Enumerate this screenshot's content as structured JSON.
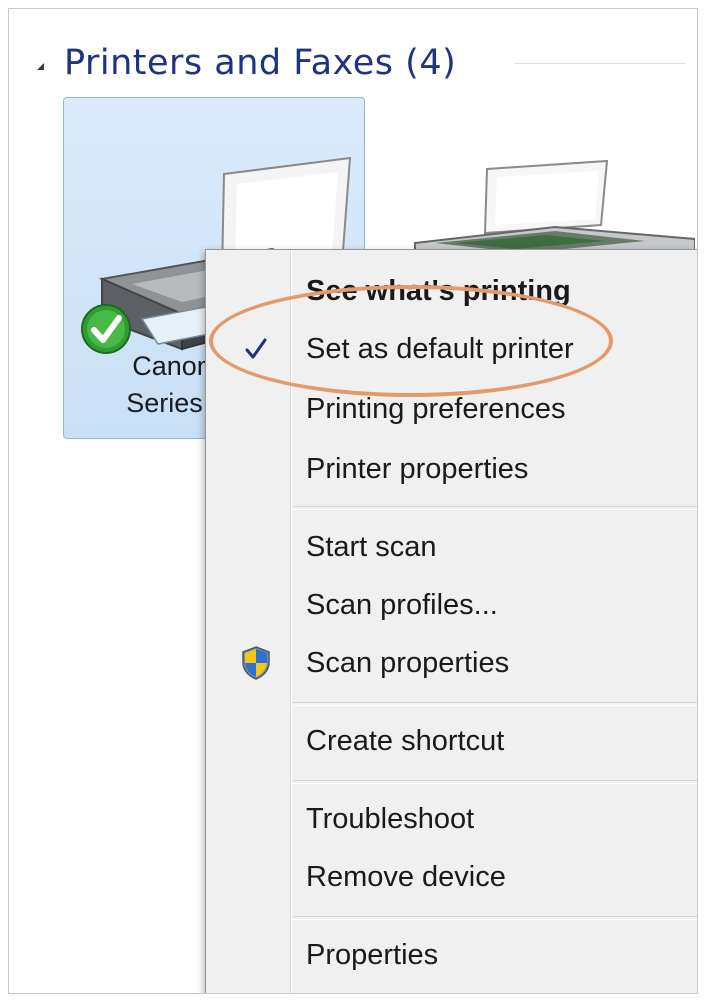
{
  "group": {
    "title": "Printers and Faxes (4)"
  },
  "devices": [
    {
      "name_line1": "Canon",
      "name_line2": "Series I"
    }
  ],
  "context_menu": {
    "items": [
      {
        "label": "See what's printing",
        "bold": true
      },
      {
        "label": "Set as default printer",
        "checked": true
      },
      {
        "label": "Printing preferences"
      },
      {
        "label": "Printer properties"
      },
      {
        "label": "Start scan"
      },
      {
        "label": "Scan profiles..."
      },
      {
        "label": "Scan properties",
        "icon": "uac-shield-icon"
      },
      {
        "label": "Create shortcut"
      },
      {
        "label": "Troubleshoot"
      },
      {
        "label": "Remove device"
      },
      {
        "label": "Properties"
      }
    ],
    "check_glyph": "✓"
  },
  "colors": {
    "group_title": "#1e3287",
    "tile_bg": "#d3e6f8",
    "menu_bg": "#f0f0f0",
    "highlight_ring": "#e39a6a",
    "check": "#1c2f86"
  }
}
